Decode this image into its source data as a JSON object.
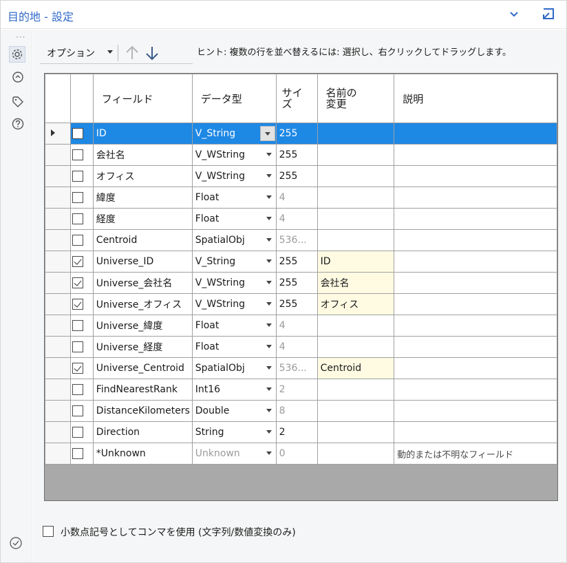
{
  "window": {
    "title": "目的地 - 設定"
  },
  "toolbar": {
    "options_label": "オプション"
  },
  "hint": "ヒント: 複数の行を並べ替えるには: 選択し、右クリックしてドラッグします。",
  "table": {
    "headers": {
      "field": "フィールド",
      "type": "データ型",
      "size": "サイ\nズ",
      "rename": "名前の\n変更",
      "description": "説明"
    },
    "rows": [
      {
        "checked": false,
        "field": "ID",
        "type": "V_String",
        "size": "255",
        "size_muted": false,
        "rename": "",
        "description": "",
        "selected": true
      },
      {
        "checked": false,
        "field": "会社名",
        "type": "V_WString",
        "size": "255",
        "size_muted": false,
        "rename": "",
        "description": ""
      },
      {
        "checked": false,
        "field": "オフィス",
        "type": "V_WString",
        "size": "255",
        "size_muted": false,
        "rename": "",
        "description": ""
      },
      {
        "checked": false,
        "field": "緯度",
        "type": "Float",
        "size": "4",
        "size_muted": true,
        "rename": "",
        "description": ""
      },
      {
        "checked": false,
        "field": "経度",
        "type": "Float",
        "size": "4",
        "size_muted": true,
        "rename": "",
        "description": ""
      },
      {
        "checked": false,
        "field": "Centroid",
        "type": "SpatialObj",
        "size": "536...",
        "size_muted": true,
        "rename": "",
        "description": ""
      },
      {
        "checked": true,
        "field": "Universe_ID",
        "type": "V_String",
        "size": "255",
        "size_muted": false,
        "rename": "ID",
        "description": ""
      },
      {
        "checked": true,
        "field": "Universe_会社名",
        "type": "V_WString",
        "size": "255",
        "size_muted": false,
        "rename": "会社名",
        "description": ""
      },
      {
        "checked": true,
        "field": "Universe_オフィス",
        "type": "V_WString",
        "size": "255",
        "size_muted": false,
        "rename": "オフィス",
        "description": ""
      },
      {
        "checked": false,
        "field": "Universe_緯度",
        "type": "Float",
        "size": "4",
        "size_muted": true,
        "rename": "",
        "description": ""
      },
      {
        "checked": false,
        "field": "Universe_経度",
        "type": "Float",
        "size": "4",
        "size_muted": true,
        "rename": "",
        "description": ""
      },
      {
        "checked": true,
        "field": "Universe_Centroid",
        "type": "SpatialObj",
        "size": "536...",
        "size_muted": true,
        "rename": "Centroid",
        "description": ""
      },
      {
        "checked": false,
        "field": "FindNearestRank",
        "type": "Int16",
        "size": "2",
        "size_muted": true,
        "rename": "",
        "description": ""
      },
      {
        "checked": false,
        "field": "DistanceKilometers",
        "type": "Double",
        "size": "8",
        "size_muted": true,
        "rename": "",
        "description": ""
      },
      {
        "checked": false,
        "field": "Direction",
        "type": "String",
        "size": "2",
        "size_muted": false,
        "rename": "",
        "description": ""
      },
      {
        "checked": false,
        "field": "*Unknown",
        "type": "Unknown",
        "size": "0",
        "size_muted": true,
        "rename": "",
        "description": "動的または不明なフィールド",
        "unknown": true
      }
    ]
  },
  "bottom": {
    "comma_label": "小数点記号としてコンマを使用 (文字列/数値変換のみ)",
    "comma_checked": false
  },
  "colors": {
    "accent": "#2f68c7",
    "selection": "#1e88e5",
    "rename_bg": "#fffbe3"
  },
  "icons": {
    "rail": [
      "gear-icon",
      "convert-icon",
      "tag-icon",
      "help-icon"
    ],
    "footer": "check-circle-icon"
  }
}
